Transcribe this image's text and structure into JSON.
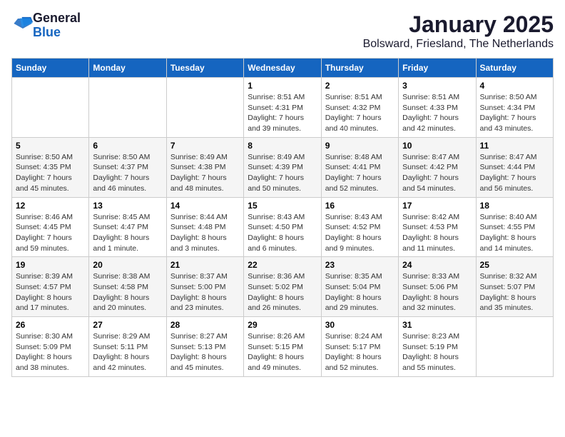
{
  "header": {
    "logo_general": "General",
    "logo_blue": "Blue",
    "month_title": "January 2025",
    "location": "Bolsward, Friesland, The Netherlands"
  },
  "weekdays": [
    "Sunday",
    "Monday",
    "Tuesday",
    "Wednesday",
    "Thursday",
    "Friday",
    "Saturday"
  ],
  "weeks": [
    [
      {
        "day": "",
        "info": ""
      },
      {
        "day": "",
        "info": ""
      },
      {
        "day": "",
        "info": ""
      },
      {
        "day": "1",
        "info": "Sunrise: 8:51 AM\nSunset: 4:31 PM\nDaylight: 7 hours\nand 39 minutes."
      },
      {
        "day": "2",
        "info": "Sunrise: 8:51 AM\nSunset: 4:32 PM\nDaylight: 7 hours\nand 40 minutes."
      },
      {
        "day": "3",
        "info": "Sunrise: 8:51 AM\nSunset: 4:33 PM\nDaylight: 7 hours\nand 42 minutes."
      },
      {
        "day": "4",
        "info": "Sunrise: 8:50 AM\nSunset: 4:34 PM\nDaylight: 7 hours\nand 43 minutes."
      }
    ],
    [
      {
        "day": "5",
        "info": "Sunrise: 8:50 AM\nSunset: 4:35 PM\nDaylight: 7 hours\nand 45 minutes."
      },
      {
        "day": "6",
        "info": "Sunrise: 8:50 AM\nSunset: 4:37 PM\nDaylight: 7 hours\nand 46 minutes."
      },
      {
        "day": "7",
        "info": "Sunrise: 8:49 AM\nSunset: 4:38 PM\nDaylight: 7 hours\nand 48 minutes."
      },
      {
        "day": "8",
        "info": "Sunrise: 8:49 AM\nSunset: 4:39 PM\nDaylight: 7 hours\nand 50 minutes."
      },
      {
        "day": "9",
        "info": "Sunrise: 8:48 AM\nSunset: 4:41 PM\nDaylight: 7 hours\nand 52 minutes."
      },
      {
        "day": "10",
        "info": "Sunrise: 8:47 AM\nSunset: 4:42 PM\nDaylight: 7 hours\nand 54 minutes."
      },
      {
        "day": "11",
        "info": "Sunrise: 8:47 AM\nSunset: 4:44 PM\nDaylight: 7 hours\nand 56 minutes."
      }
    ],
    [
      {
        "day": "12",
        "info": "Sunrise: 8:46 AM\nSunset: 4:45 PM\nDaylight: 7 hours\nand 59 minutes."
      },
      {
        "day": "13",
        "info": "Sunrise: 8:45 AM\nSunset: 4:47 PM\nDaylight: 8 hours\nand 1 minute."
      },
      {
        "day": "14",
        "info": "Sunrise: 8:44 AM\nSunset: 4:48 PM\nDaylight: 8 hours\nand 3 minutes."
      },
      {
        "day": "15",
        "info": "Sunrise: 8:43 AM\nSunset: 4:50 PM\nDaylight: 8 hours\nand 6 minutes."
      },
      {
        "day": "16",
        "info": "Sunrise: 8:43 AM\nSunset: 4:52 PM\nDaylight: 8 hours\nand 9 minutes."
      },
      {
        "day": "17",
        "info": "Sunrise: 8:42 AM\nSunset: 4:53 PM\nDaylight: 8 hours\nand 11 minutes."
      },
      {
        "day": "18",
        "info": "Sunrise: 8:40 AM\nSunset: 4:55 PM\nDaylight: 8 hours\nand 14 minutes."
      }
    ],
    [
      {
        "day": "19",
        "info": "Sunrise: 8:39 AM\nSunset: 4:57 PM\nDaylight: 8 hours\nand 17 minutes."
      },
      {
        "day": "20",
        "info": "Sunrise: 8:38 AM\nSunset: 4:58 PM\nDaylight: 8 hours\nand 20 minutes."
      },
      {
        "day": "21",
        "info": "Sunrise: 8:37 AM\nSunset: 5:00 PM\nDaylight: 8 hours\nand 23 minutes."
      },
      {
        "day": "22",
        "info": "Sunrise: 8:36 AM\nSunset: 5:02 PM\nDaylight: 8 hours\nand 26 minutes."
      },
      {
        "day": "23",
        "info": "Sunrise: 8:35 AM\nSunset: 5:04 PM\nDaylight: 8 hours\nand 29 minutes."
      },
      {
        "day": "24",
        "info": "Sunrise: 8:33 AM\nSunset: 5:06 PM\nDaylight: 8 hours\nand 32 minutes."
      },
      {
        "day": "25",
        "info": "Sunrise: 8:32 AM\nSunset: 5:07 PM\nDaylight: 8 hours\nand 35 minutes."
      }
    ],
    [
      {
        "day": "26",
        "info": "Sunrise: 8:30 AM\nSunset: 5:09 PM\nDaylight: 8 hours\nand 38 minutes."
      },
      {
        "day": "27",
        "info": "Sunrise: 8:29 AM\nSunset: 5:11 PM\nDaylight: 8 hours\nand 42 minutes."
      },
      {
        "day": "28",
        "info": "Sunrise: 8:27 AM\nSunset: 5:13 PM\nDaylight: 8 hours\nand 45 minutes."
      },
      {
        "day": "29",
        "info": "Sunrise: 8:26 AM\nSunset: 5:15 PM\nDaylight: 8 hours\nand 49 minutes."
      },
      {
        "day": "30",
        "info": "Sunrise: 8:24 AM\nSunset: 5:17 PM\nDaylight: 8 hours\nand 52 minutes."
      },
      {
        "day": "31",
        "info": "Sunrise: 8:23 AM\nSunset: 5:19 PM\nDaylight: 8 hours\nand 55 minutes."
      },
      {
        "day": "",
        "info": ""
      }
    ]
  ]
}
